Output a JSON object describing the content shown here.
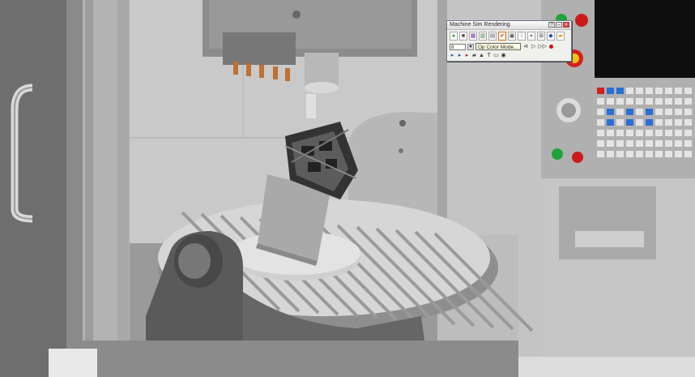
{
  "window": {
    "title": "Machine Sim Rendering"
  },
  "title_buttons": [
    "?",
    "–",
    "×"
  ],
  "toolbar_row1": [
    {
      "icon": "green-sphere-icon",
      "glyph": "●",
      "color": "#2e9e2e"
    },
    {
      "icon": "solid-shade-icon",
      "glyph": "■",
      "color": "#444444"
    },
    {
      "icon": "color-shade-icon",
      "glyph": "▦",
      "color": "#7a3aa8"
    },
    {
      "icon": "wireframe-icon",
      "glyph": "▥",
      "color": "#3a7a3a"
    },
    {
      "icon": "edges-icon",
      "glyph": "▤",
      "color": "#555555"
    },
    {
      "icon": "op-color-mode-icon",
      "glyph": "✔",
      "color": "#cc2222"
    },
    {
      "icon": "lock-icon",
      "glyph": "▣",
      "color": "#555555"
    },
    {
      "icon": "sequence-icon",
      "glyph": "⁞",
      "color": "#333333"
    },
    {
      "icon": "axes-icon",
      "glyph": "⌖",
      "color": "#333333"
    },
    {
      "icon": "grid-view-icon",
      "glyph": "⊞",
      "color": "#444444"
    },
    {
      "icon": "blue-cube-icon",
      "glyph": "◆",
      "color": "#1f47c7"
    },
    {
      "icon": "folder-icon",
      "glyph": "▰",
      "color": "#d6a11c"
    }
  ],
  "step_field": {
    "value": "8"
  },
  "tooltip": "Op Color Mode...",
  "playback": [
    {
      "icon": "step-back-icon",
      "glyph": "⊲"
    },
    {
      "icon": "play-icon",
      "glyph": "▷"
    },
    {
      "icon": "fast-forward-icon",
      "glyph": "▷▷"
    }
  ],
  "toolbar_row3": [
    {
      "icon": "speed-low-icon",
      "glyph": "▸",
      "color": "#2255aa"
    },
    {
      "icon": "speed-med-icon",
      "glyph": "▸",
      "color": "#2255aa"
    },
    {
      "icon": "speed-high-icon",
      "glyph": "▸",
      "color": "#aa2222"
    },
    {
      "icon": "machine-icon",
      "glyph": "▰",
      "color": "#555555"
    },
    {
      "icon": "warning-icon",
      "glyph": "▲",
      "color": "#333333"
    },
    {
      "icon": "tool-icon",
      "glyph": "T",
      "color": "#333333"
    },
    {
      "icon": "window-icon",
      "glyph": "▭",
      "color": "#333333"
    },
    {
      "icon": "eye-icon",
      "glyph": "◉",
      "color": "#333333"
    }
  ],
  "colors": {
    "enclosure_dark": "#666666",
    "enclosure": "#c8c8c8",
    "panel": "#b9b9b9",
    "screen": "#111111",
    "key_blue": "#2a6fd6",
    "key_red": "#d42020",
    "button_green": "#1ea33a",
    "button_red": "#cc1a1a"
  }
}
